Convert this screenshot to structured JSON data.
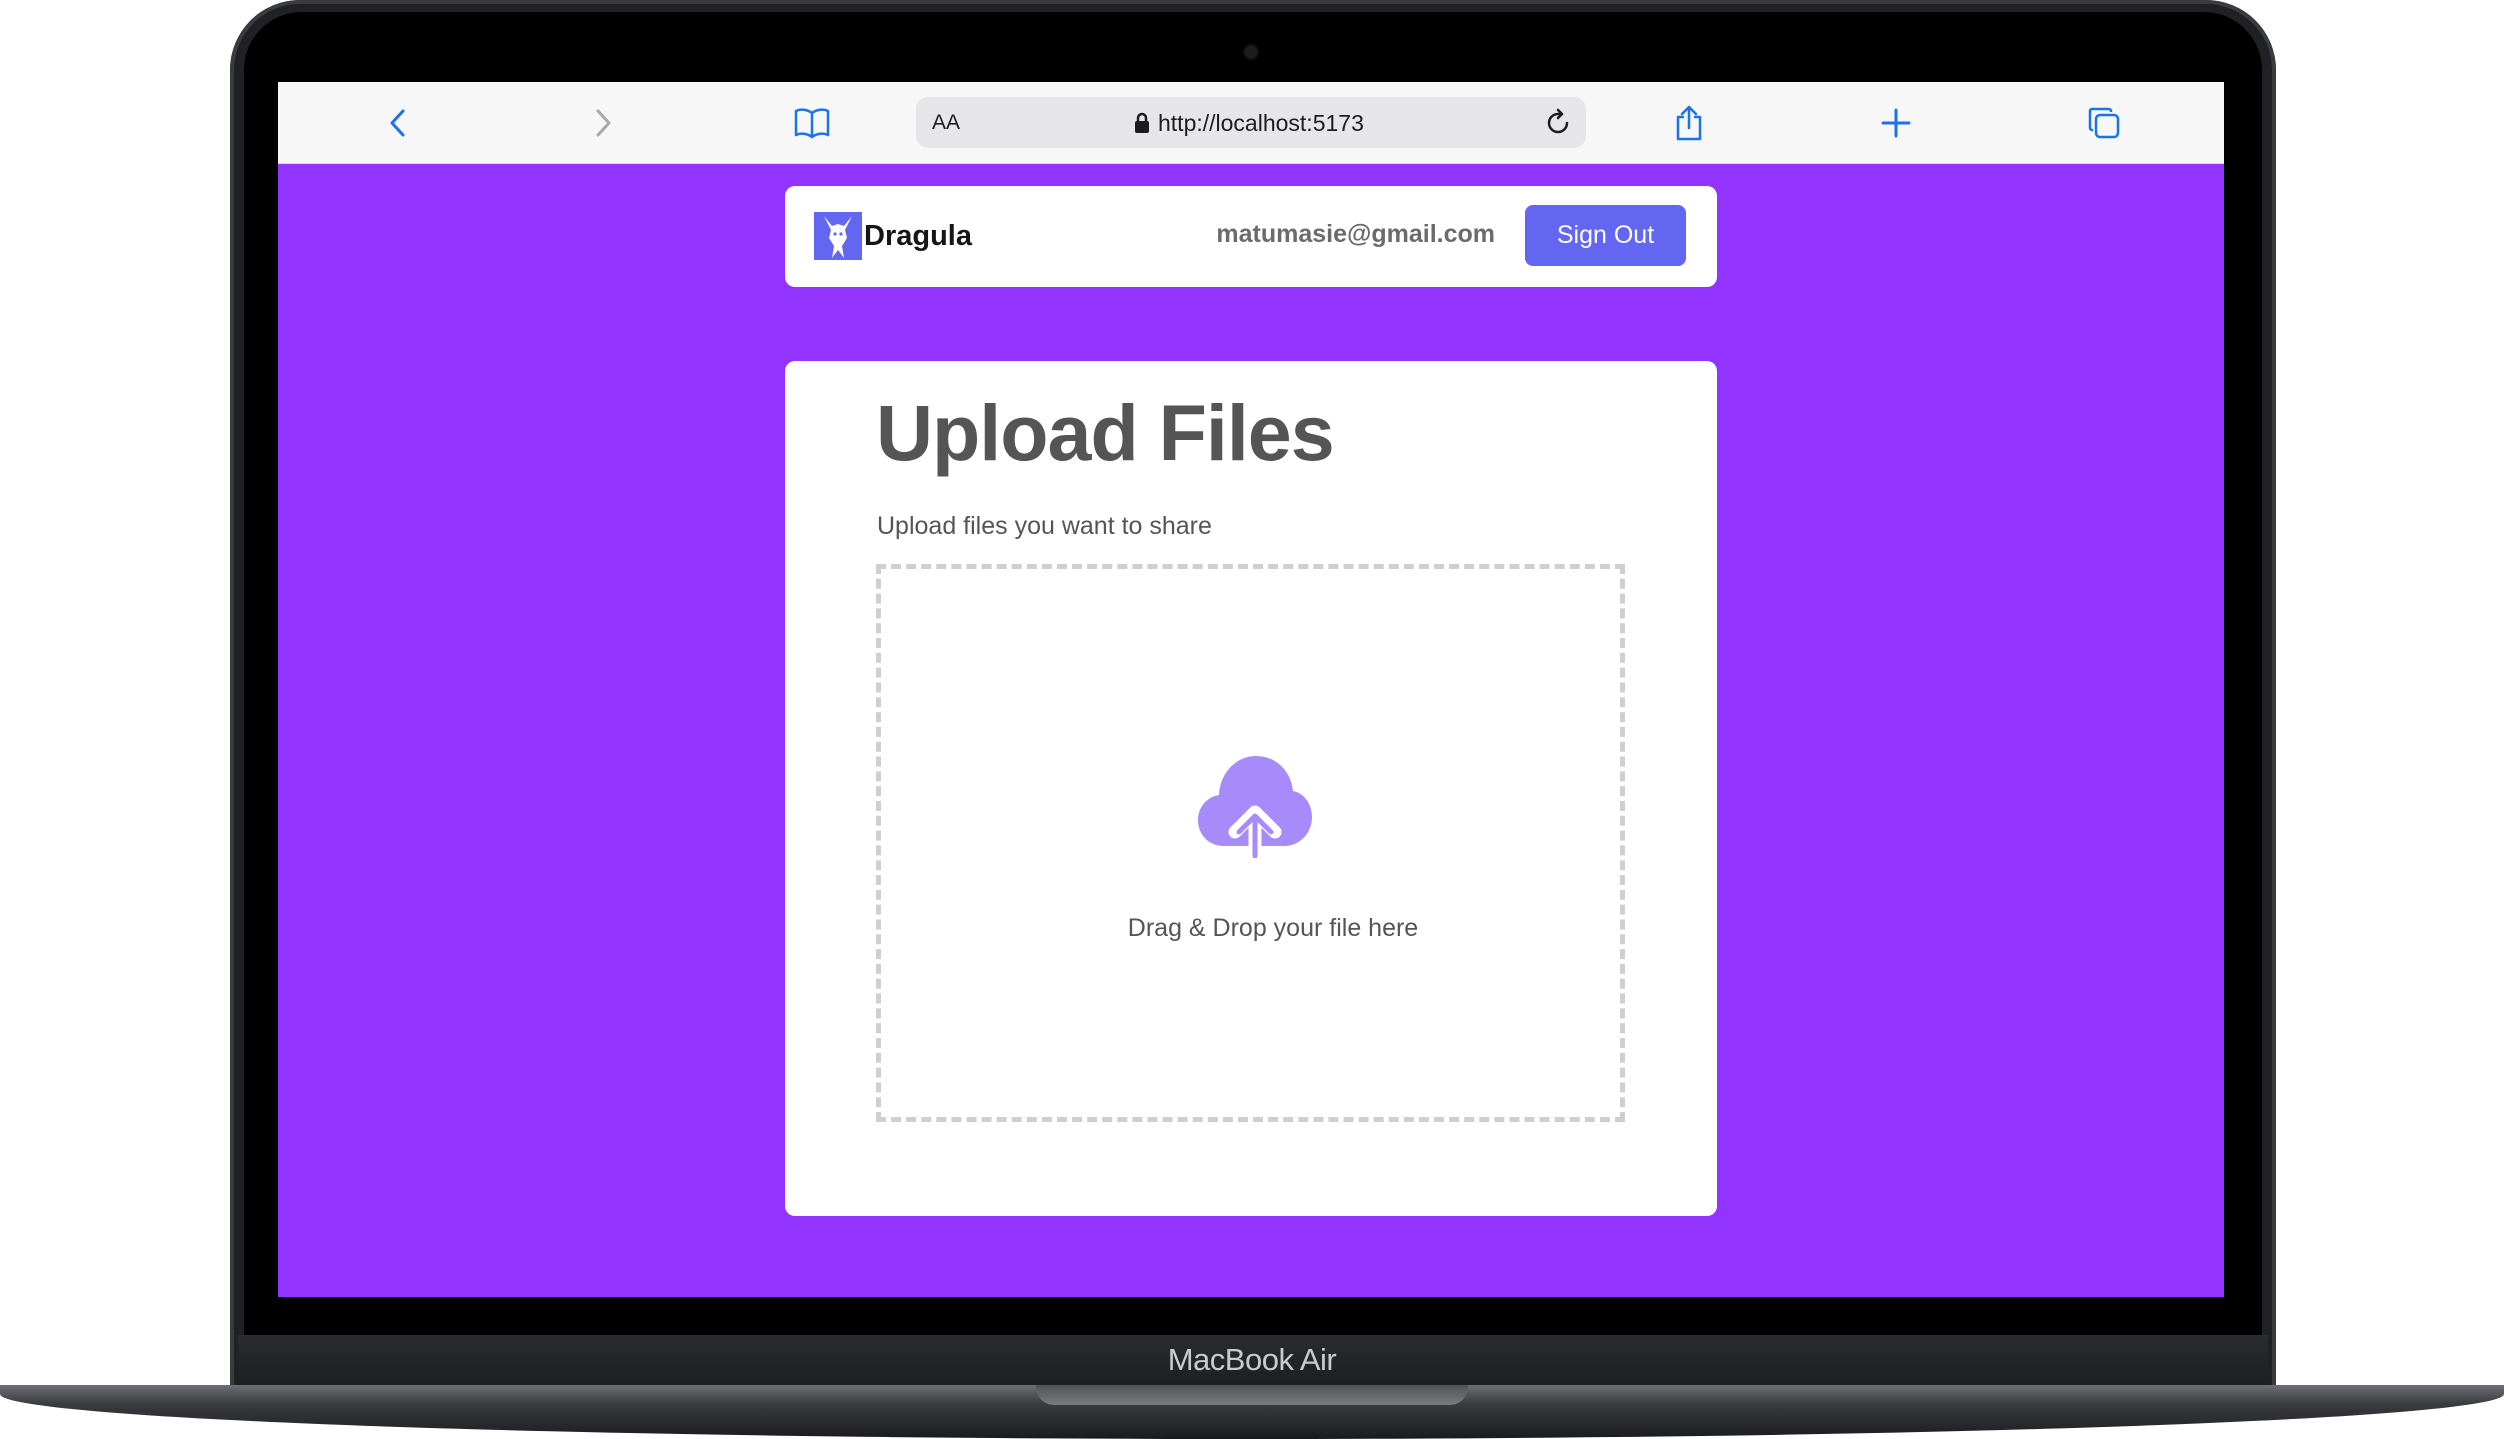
{
  "device": {
    "model_label": "MacBook Air"
  },
  "browser": {
    "text_size_label": "AA",
    "url": "http://localhost:5173",
    "icons": [
      "back-icon",
      "forward-icon",
      "bookmarks-icon",
      "lock-icon",
      "reload-icon",
      "share-icon",
      "new-tab-icon",
      "tabs-icon"
    ]
  },
  "header": {
    "app_name": "Dragula",
    "user_email": "matumasie@gmail.com",
    "sign_out_label": "Sign Out"
  },
  "upload": {
    "title": "Upload Files",
    "subtitle": "Upload files you want to share",
    "drop_hint": "Drag & Drop your file here",
    "icon": "cloud-upload-icon"
  },
  "colors": {
    "page_background": "#9333ff",
    "accent": "#6366f1",
    "cloud_icon": "#a78bfa",
    "browser_icons": "#1a73e8"
  }
}
